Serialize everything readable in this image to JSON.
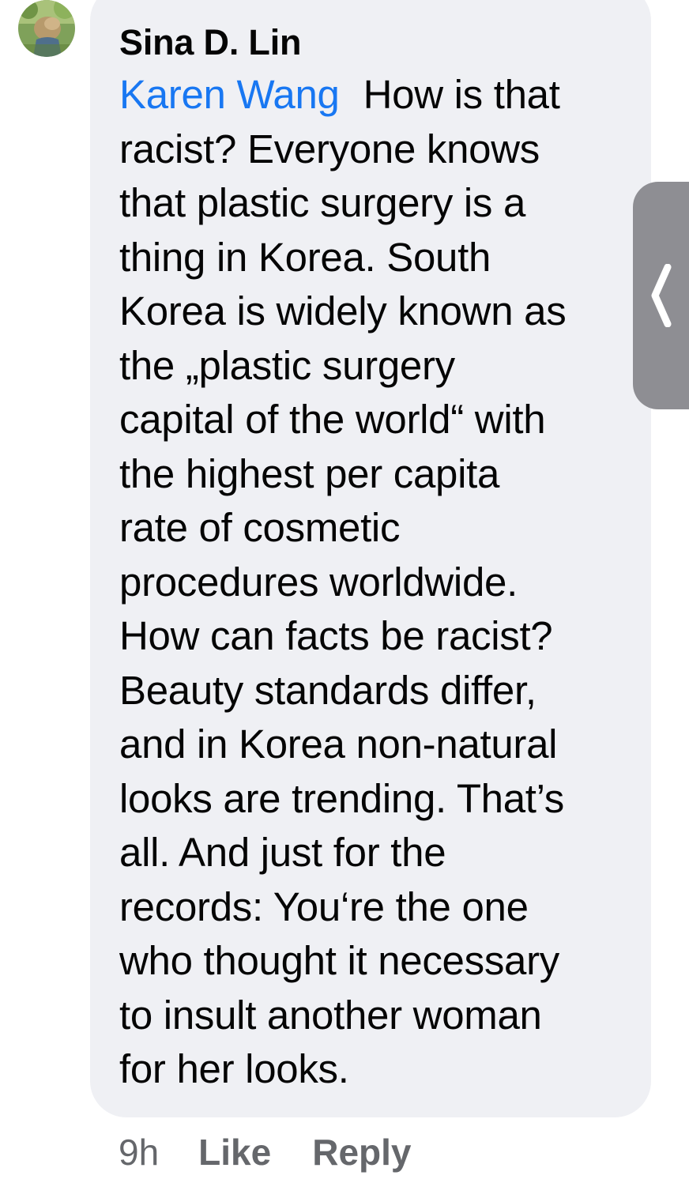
{
  "comment": {
    "author": "Sina D. Lin",
    "mention": "Karen Wang",
    "lines": [
      "How is that",
      "racist? Everyone knows",
      "that plastic surgery is a",
      "thing in Korea. South",
      "Korea is widely known as",
      "the „plastic surgery",
      "capital of the world“ with",
      "the highest per capita",
      "rate of cosmetic",
      "procedures worldwide.",
      "How can facts be racist?",
      "Beauty standards differ,",
      "and in Korea non-natural",
      "looks are trending. That’s",
      "all. And just for the",
      "records: You‘re the one",
      "who thought it necessary",
      "to insult another woman",
      "for her looks."
    ]
  },
  "actions": {
    "timestamp": "9h",
    "like_label": "Like",
    "reply_label": "Reply"
  },
  "colors": {
    "bubble": "#eff0f4",
    "mention": "#1877f2",
    "meta": "#65676b",
    "handle": "#8e8e93"
  },
  "icons": {
    "avatar": "profile-photo",
    "side_handle": "chevron-left-icon"
  }
}
